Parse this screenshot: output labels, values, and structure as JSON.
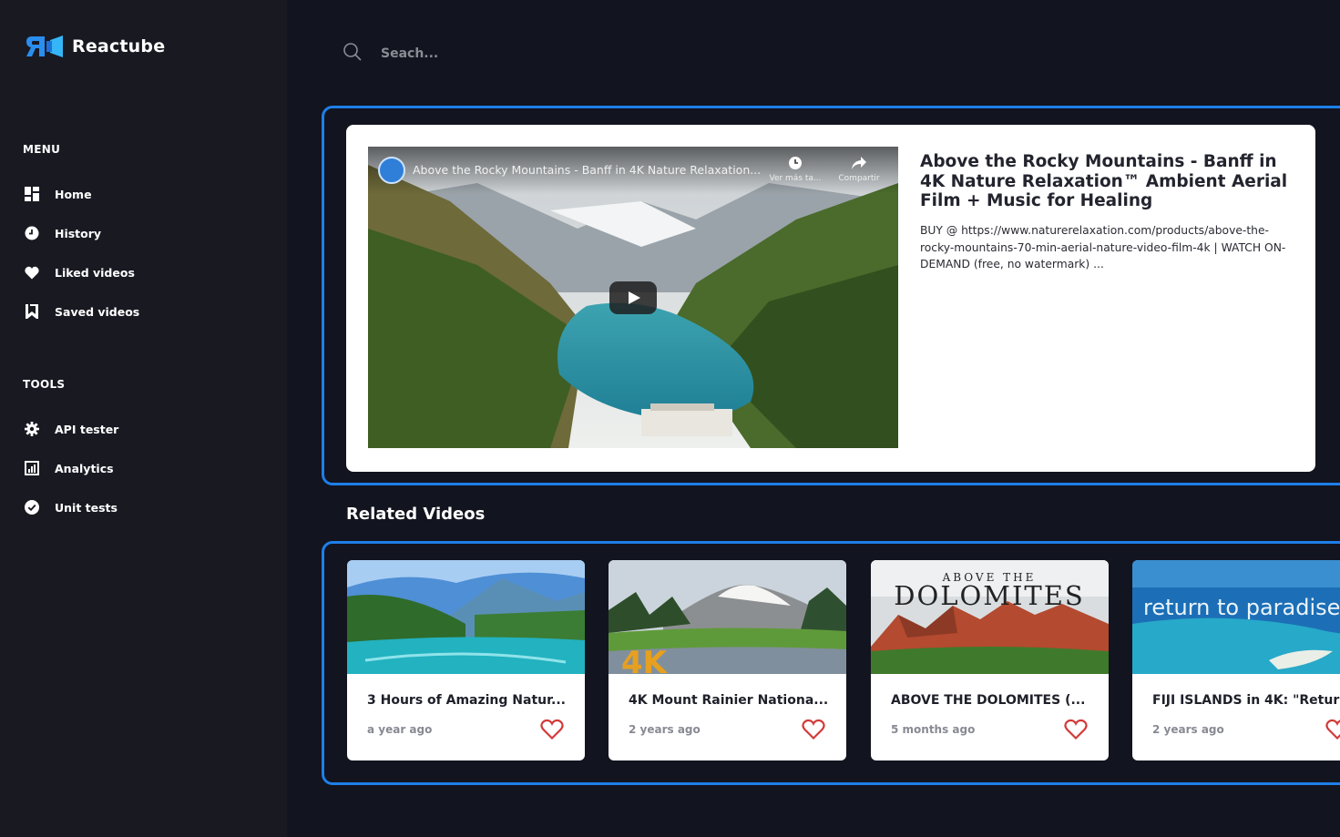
{
  "app": {
    "name": "Reactube"
  },
  "colors": {
    "accent": "#1e7fe8",
    "background": "#12141f",
    "sidebar": "#191922",
    "heart": "#d33a3a"
  },
  "sidebar": {
    "menu_title": "MENU",
    "menu_items": [
      {
        "label": "Home",
        "icon": "grid-icon"
      },
      {
        "label": "History",
        "icon": "clock-icon"
      },
      {
        "label": "Liked videos",
        "icon": "heart-icon"
      },
      {
        "label": "Saved videos",
        "icon": "bookmark-icon"
      }
    ],
    "tools_title": "TOOLS",
    "tool_items": [
      {
        "label": "API tester",
        "icon": "gear-icon"
      },
      {
        "label": "Analytics",
        "icon": "chart-icon"
      },
      {
        "label": "Unit tests",
        "icon": "check-circle-icon"
      }
    ]
  },
  "search": {
    "placeholder": "Seach..."
  },
  "featured": {
    "player_title": "Above the Rocky Mountains - Banff in 4K Nature Relaxation...",
    "watch_later_label": "Ver más ta...",
    "share_label": "Compartir",
    "title": "Above the Rocky Mountains - Banff in 4K Nature Relaxation™ Ambient Aerial Film + Music for Healing",
    "description": "BUY @ https://www.naturerelaxation.com/products/above-the-rocky-mountains-70-min-aerial-nature-video-film-4k | WATCH ON-DEMAND (free, no watermark) ..."
  },
  "related": {
    "heading": "Related Videos",
    "videos": [
      {
        "title": "3 Hours of Amazing Natur...",
        "time": "a year ago",
        "thumb_text": ""
      },
      {
        "title": "4K Mount Rainier Nationa...",
        "time": "2 years ago",
        "thumb_text": "4K"
      },
      {
        "title": "ABOVE THE DOLOMITES (...",
        "time": "5 months ago",
        "thumb_text": "ABOVE THE",
        "thumb_text2": "DOLOMITES"
      },
      {
        "title": "FIJI ISLANDS in 4K: \"Retur",
        "time": "2 years ago",
        "thumb_text": "return to paradise"
      }
    ]
  }
}
